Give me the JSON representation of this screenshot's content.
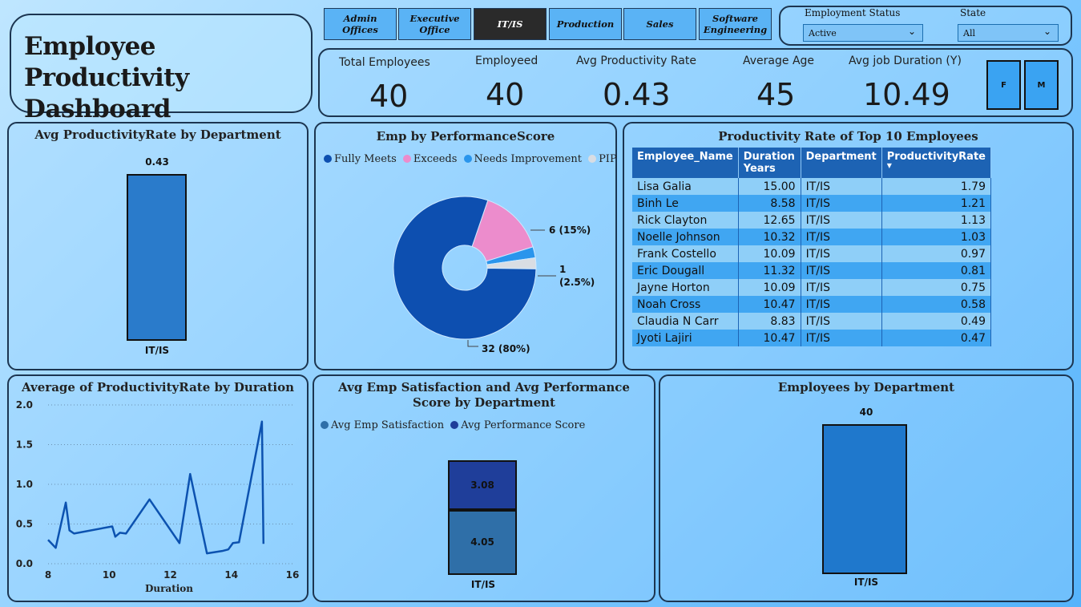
{
  "header": {
    "title": "Employee Productivity Dashboard"
  },
  "tabs": [
    {
      "label": "Admin Offices",
      "active": false
    },
    {
      "label": "Executive Office",
      "active": false
    },
    {
      "label": "IT/IS",
      "active": true
    },
    {
      "label": "Production",
      "active": false
    },
    {
      "label": "Sales",
      "active": false
    },
    {
      "label": "Software Engineering",
      "active": false
    }
  ],
  "filters": {
    "employment_status": {
      "label": "Employment Status",
      "value": "Active"
    },
    "state": {
      "label": "State",
      "value": "All"
    }
  },
  "kpis": [
    {
      "label": "Total Employees",
      "value": "40"
    },
    {
      "label": "Employeed",
      "value": "40"
    },
    {
      "label": "Avg Productivity Rate",
      "value": "0.43"
    },
    {
      "label": "Average Age",
      "value": "45"
    },
    {
      "label": "Avg job Duration (Y)",
      "value": "10.49"
    }
  ],
  "gender_buttons": [
    "F",
    "M"
  ],
  "colors": {
    "accent": "#2a7bcb",
    "fully_meets": "#0d4fb0",
    "exceeds": "#ec8ccc",
    "needs_improvement": "#2a95ec",
    "pip": "#d9dde3",
    "satisfaction": "#2f6fa8",
    "performance": "#1f3e9a"
  },
  "chart_data": [
    {
      "type": "bar",
      "title": "Avg ProductivityRate by Department",
      "categories": [
        "IT/IS"
      ],
      "values": [
        0.43
      ],
      "data_labels": [
        "0.43"
      ]
    },
    {
      "type": "pie",
      "title": "Emp by PerformanceScore",
      "legend": [
        "Fully Meets",
        "Exceeds",
        "Needs Improvement",
        "PIP"
      ],
      "legend_position": "top",
      "slices": [
        {
          "name": "Fully Meets",
          "value": 32,
          "label": "32 (80%)"
        },
        {
          "name": "Exceeds",
          "value": 6,
          "label": "6 (15%)"
        },
        {
          "name": "Needs Improvement",
          "value": 1,
          "label": ""
        },
        {
          "name": "PIP",
          "value": 1,
          "label": "1 (2.5%)"
        }
      ]
    },
    {
      "type": "table",
      "title": "Productivity Rate of Top 10 Employees",
      "columns": [
        "Employee_Name",
        "Duration Years",
        "Department",
        "ProductivityRate"
      ],
      "rows": [
        [
          "Lisa Galia",
          "15.00",
          "IT/IS",
          "1.79"
        ],
        [
          "Binh Le",
          "8.58",
          "IT/IS",
          "1.21"
        ],
        [
          "Rick Clayton",
          "12.65",
          "IT/IS",
          "1.13"
        ],
        [
          "Noelle Johnson",
          "10.32",
          "IT/IS",
          "1.03"
        ],
        [
          "Frank Costello",
          "10.09",
          "IT/IS",
          "0.97"
        ],
        [
          "Eric Dougall",
          "11.32",
          "IT/IS",
          "0.81"
        ],
        [
          "Jayne Horton",
          "10.09",
          "IT/IS",
          "0.75"
        ],
        [
          "Noah Cross",
          "10.47",
          "IT/IS",
          "0.58"
        ],
        [
          "Claudia N Carr",
          "8.83",
          "IT/IS",
          "0.49"
        ],
        [
          "Jyoti Lajiri",
          "10.47",
          "IT/IS",
          "0.47"
        ]
      ]
    },
    {
      "type": "line",
      "title": "Average of ProductivityRate by Duration",
      "xlabel": "Duration",
      "ylabel": "",
      "xlim": [
        8,
        16
      ],
      "ylim": [
        0,
        2
      ],
      "xticks": [
        "8",
        "10",
        "12",
        "14",
        "16"
      ],
      "yticks": [
        "0.0",
        "0.5",
        "1.0",
        "1.5",
        "2.0"
      ],
      "grid": true,
      "x": [
        8.0,
        8.25,
        8.58,
        8.7,
        8.85,
        10.1,
        10.2,
        10.35,
        10.55,
        11.32,
        12.3,
        12.65,
        13.2,
        13.7,
        13.9,
        14.05,
        14.25,
        15.0,
        15.05
      ],
      "y": [
        0.3,
        0.2,
        0.77,
        0.42,
        0.38,
        0.47,
        0.34,
        0.39,
        0.38,
        0.81,
        0.26,
        1.13,
        0.13,
        0.16,
        0.18,
        0.26,
        0.27,
        1.79,
        0.25
      ]
    },
    {
      "type": "bar",
      "title": "Avg Emp Satisfaction and Avg Performance Score by Department",
      "categories": [
        "IT/IS"
      ],
      "legend": [
        "Avg Emp Satisfaction",
        "Avg Performance Score"
      ],
      "legend_position": "top-left",
      "stacked": true,
      "series": [
        {
          "name": "Avg Emp Satisfaction",
          "values": [
            4.05
          ],
          "label": "4.05"
        },
        {
          "name": "Avg Performance Score",
          "values": [
            3.08
          ],
          "label": "3.08"
        }
      ]
    },
    {
      "type": "bar",
      "title": "Employees by Department",
      "categories": [
        "IT/IS"
      ],
      "values": [
        40
      ],
      "data_labels": [
        "40"
      ]
    }
  ]
}
